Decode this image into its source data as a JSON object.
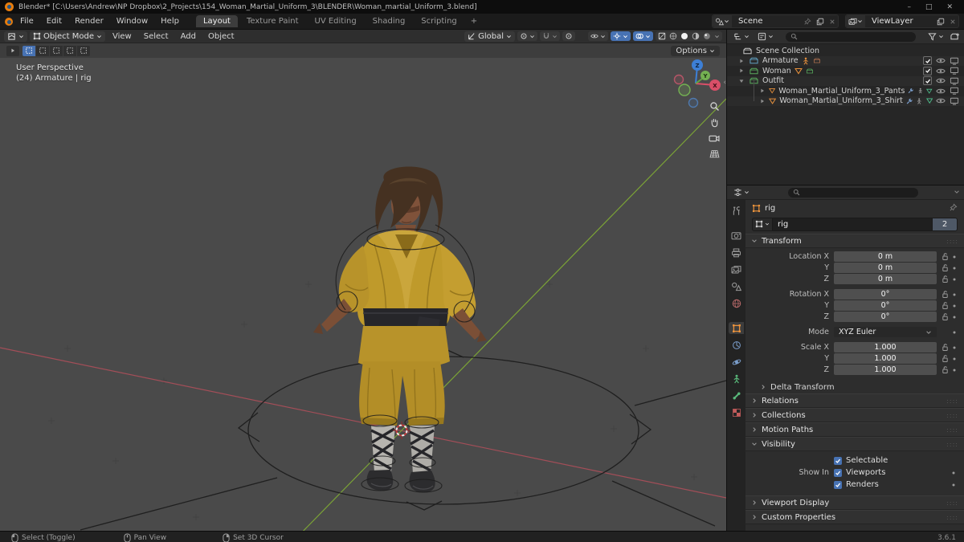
{
  "window": {
    "title": "Blender* [C:\\Users\\Andrew\\NP Dropbox\\2_Projects\\154_Woman_Martial_Uniform_3\\BLENDER\\Woman_martial_Uniform_3.blend]",
    "minimize": "–",
    "maximize": "□",
    "close": "✕"
  },
  "topbar": {
    "menus": [
      "File",
      "Edit",
      "Render",
      "Window",
      "Help"
    ],
    "workspaces": [
      "Layout",
      "Texture Paint",
      "UV Editing",
      "Shading",
      "Scripting"
    ],
    "add_workspace_label": "+",
    "scene_selector": {
      "value": "Scene"
    },
    "view_layer_selector": {
      "value": "ViewLayer"
    }
  },
  "viewport": {
    "header": {
      "mode": "Object Mode",
      "menus": [
        "View",
        "Select",
        "Add",
        "Object"
      ],
      "orientation": "Global"
    },
    "tool_settings": {
      "options_label": "Options"
    },
    "overlay": {
      "view_label": "User Perspective",
      "selection_label": "(24) Armature | rig"
    },
    "gizmo_axes": {
      "x": "X",
      "y": "Y",
      "z": "Z"
    },
    "colors": {
      "background": "#4a4a4a",
      "axis_x": "#a34e58",
      "axis_y": "#7ba336",
      "accent": "#4772b3"
    }
  },
  "outliner": {
    "rows": [
      {
        "label": "Scene Collection"
      },
      {
        "label": "Armature"
      },
      {
        "label": "Woman"
      },
      {
        "label": "Outfit"
      },
      {
        "label": "Woman_Martial_Uniform_3_Pants"
      },
      {
        "label": "Woman_Martial_Uniform_3_Shirt"
      }
    ]
  },
  "properties": {
    "breadcrumb": "rig",
    "name_field": {
      "value": "rig",
      "users_count": "2"
    },
    "transform": {
      "title": "Transform",
      "fields": [
        {
          "label": "Location X",
          "value": "0 m"
        },
        {
          "label": "Y",
          "value": "0 m"
        },
        {
          "label": "Z",
          "value": "0 m"
        },
        {
          "label": "Rotation X",
          "value": "0°"
        },
        {
          "label": "Y",
          "value": "0°"
        },
        {
          "label": "Z",
          "value": "0°"
        },
        {
          "label": "Mode",
          "value": "XYZ Euler"
        },
        {
          "label": "Scale X",
          "value": "1.000"
        },
        {
          "label": "Y",
          "value": "1.000"
        },
        {
          "label": "Z",
          "value": "1.000"
        }
      ]
    },
    "collapsed_panels": [
      "Delta Transform",
      "Relations",
      "Collections",
      "Motion Paths"
    ],
    "visibility": {
      "title": "Visibility",
      "selectable_label": "Selectable",
      "show_in_label": "Show In",
      "viewports_label": "Viewports",
      "renders_label": "Renders"
    },
    "bottom_panels": [
      "Viewport Display",
      "Custom Properties"
    ],
    "accent_color": "#4772b3"
  },
  "statusbar": {
    "hints": [
      {
        "label": "Select (Toggle)"
      },
      {
        "label": "Pan View"
      },
      {
        "label": "Set 3D Cursor"
      }
    ],
    "version": "3.6.1"
  }
}
